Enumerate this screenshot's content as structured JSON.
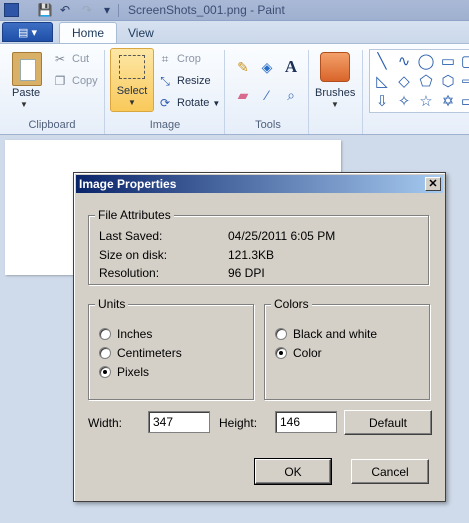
{
  "app": {
    "window_title": "ScreenShots_001.png - Paint"
  },
  "ribbon": {
    "tabs": [
      "Home",
      "View"
    ],
    "clipboard": {
      "paste": "Paste",
      "cut": "Cut",
      "copy": "Copy",
      "label": "Clipboard"
    },
    "image": {
      "select": "Select",
      "crop": "Crop",
      "resize": "Resize",
      "rotate": "Rotate",
      "label": "Image"
    },
    "tools": {
      "label": "Tools"
    },
    "brushes": {
      "label": "Brushes"
    }
  },
  "dialog": {
    "title": "Image Properties",
    "close_glyph": "✕",
    "file_attributes": {
      "title": "File Attributes",
      "rows": [
        {
          "label": "Last Saved:",
          "value": "04/25/2011 6:05 PM"
        },
        {
          "label": "Size on disk:",
          "value": "121.3KB"
        },
        {
          "label": "Resolution:",
          "value": "96 DPI"
        }
      ]
    },
    "units": {
      "title": "Units",
      "options": [
        "Inches",
        "Centimeters",
        "Pixels"
      ],
      "selected": "Pixels"
    },
    "colors": {
      "title": "Colors",
      "options": [
        "Black and white",
        "Color"
      ],
      "selected": "Color"
    },
    "width_label": "Width:",
    "width_value": "347",
    "height_label": "Height:",
    "height_value": "146",
    "default_button": "Default",
    "ok_button": "OK",
    "cancel_button": "Cancel"
  }
}
